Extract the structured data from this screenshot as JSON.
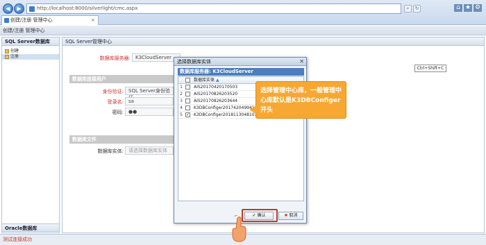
{
  "browser": {
    "url": "http://localhost:8000/silverlight/cmc.aspx",
    "tab_title": "创建/注册 管理中心",
    "tab_close": "×",
    "back_icon": "back-arrow-icon",
    "forward_icon": "forward-arrow-icon"
  },
  "app": {
    "title": "创建/注册 管理中心",
    "status": "测试连接成功",
    "accent": "#4a7fbd"
  },
  "left_panel": {
    "header": "SQL Server数据库",
    "items": [
      {
        "label": "创建",
        "icon": "folder-icon"
      },
      {
        "label": "注册",
        "icon": "folder-icon"
      }
    ],
    "footer": "Oracle数据库"
  },
  "main_panel": {
    "header": "SQL Server管理中心",
    "server_label": "数据库服务器:",
    "server_value": "K3CloudServer",
    "section_admin": "数据库连接用户",
    "auth_label": "身份验证:",
    "auth_value": "SQL Server身份验证",
    "login_label": "登录名:",
    "login_value": "sa",
    "password_label": "密码:",
    "password_value": "●●",
    "section_files": "数据库文件",
    "instance_label": "数据库实体:",
    "instance_placeholder": "请选择数据库实体"
  },
  "dialog": {
    "title": "选择数据库实体",
    "close": "✕",
    "server_line": "数据库服务器: K3CloudServer",
    "column_header": "数据库实体",
    "sort_indicator": "▲",
    "rows": [
      {
        "n": "1",
        "name": "AIS20170420170503",
        "checked": false
      },
      {
        "n": "2",
        "name": "AIS20170826203520",
        "checked": false
      },
      {
        "n": "3",
        "name": "AIS20170826203644",
        "checked": false
      },
      {
        "n": "4",
        "name": "K3DBConfiger2017420499418",
        "checked": false
      },
      {
        "n": "5",
        "name": "K3DBConfiger201811304810371",
        "checked": true
      }
    ],
    "ok": "确认",
    "cancel": "取消"
  },
  "callout": {
    "text": "选择管理中心库，一般管理中心库默认是K3DBConfiger开头"
  },
  "hotkey_hint": "Ctrl+Shift+C"
}
